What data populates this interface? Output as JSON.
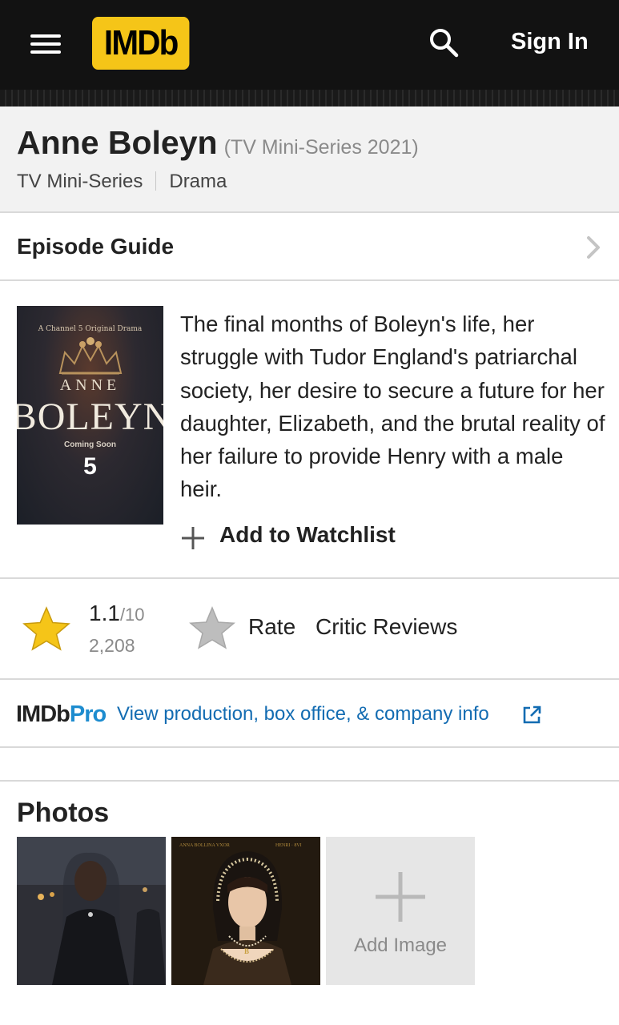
{
  "header": {
    "logo_text": "IMDb",
    "sign_in": "Sign In"
  },
  "title": {
    "name": "Anne Boleyn",
    "meta": "(TV Mini-Series 2021)",
    "genres": [
      "TV Mini-Series",
      "Drama"
    ]
  },
  "episode_guide": {
    "label": "Episode Guide"
  },
  "overview": {
    "poster": {
      "top_text": "A Channel 5 Original Drama",
      "title_line1": "ANNE",
      "title_line2": "BOLEYN",
      "coming_soon": "Coming Soon",
      "channel": "5"
    },
    "plot": "The final months of Boleyn's life, her struggle with Tudor England's patriarchal society, her desire to secure a future for her daughter, Elizabeth, and the brutal reality of her failure to provide Henry with a male heir.",
    "watchlist_label": "Add to Watchlist"
  },
  "ratings": {
    "value": "1.1",
    "out_of": "/10",
    "count": "2,208",
    "rate_label": "Rate",
    "critic_reviews_label": "Critic Reviews"
  },
  "pro": {
    "logo_imdb": "IMDb",
    "logo_pro": "Pro",
    "link_text": "View production, box office, & company info"
  },
  "photos": {
    "title": "Photos",
    "add_image_label": "Add Image",
    "photo2_caption_left": "ANNA BOLLINA VXOR",
    "photo2_caption_right": "HENRI · 8VI",
    "photo2_pendant": "B"
  },
  "colors": {
    "brand_yellow": "#f5c518",
    "topbar_bg": "#121212",
    "link_blue": "#136cb2",
    "pro_blue": "#1d8ccf",
    "star_gold": "#f5c518"
  },
  "icons": [
    "hamburger-icon",
    "search-icon",
    "chevron-right-icon",
    "plus-icon",
    "star-filled-icon",
    "star-outline-icon",
    "external-link-icon"
  ]
}
